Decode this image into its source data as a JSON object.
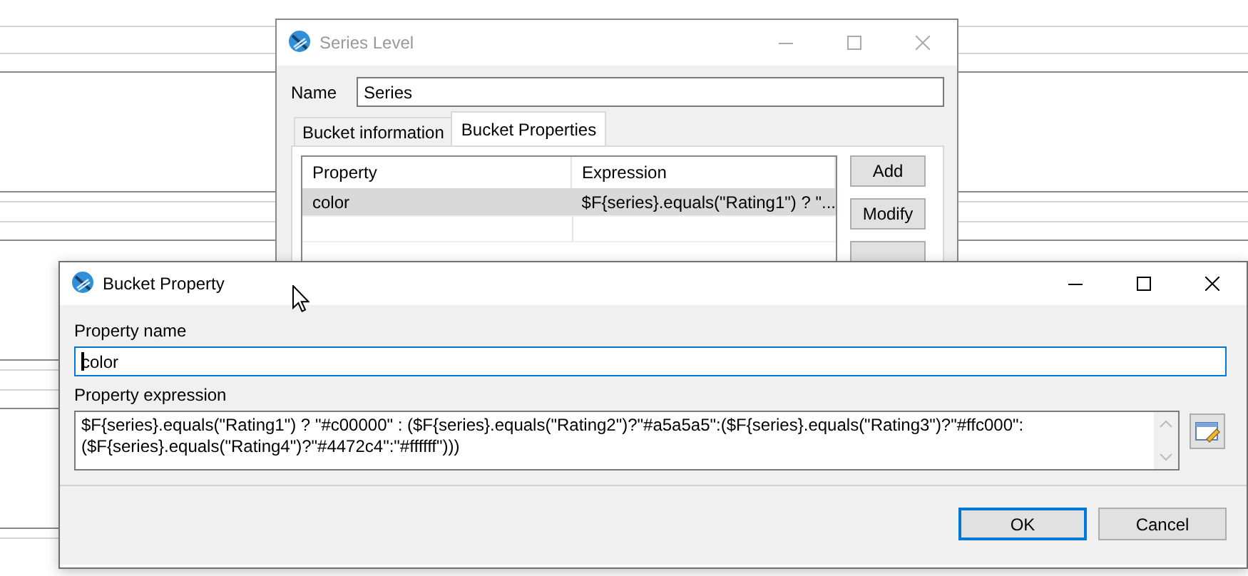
{
  "series_level_window": {
    "title": "Series Level",
    "active": false,
    "name_label": "Name",
    "name_value": "Series",
    "tabs": [
      {
        "label": "Bucket information",
        "selected": false
      },
      {
        "label": "Bucket Properties",
        "selected": true
      }
    ],
    "table": {
      "columns": [
        "Property",
        "Expression"
      ],
      "rows": [
        {
          "cells": [
            "color",
            "$F{series}.equals(\"Rating1\") ? \"..."
          ],
          "selected": true
        }
      ]
    },
    "buttons": [
      "Add",
      "Modify"
    ]
  },
  "bucket_property_window": {
    "title": "Bucket Property",
    "active": true,
    "property_name_label": "Property name",
    "property_name_value": "color",
    "property_expression_label": "Property expression",
    "property_expression_value": "$F{series}.equals(\"Rating1\") ? \"#c00000\" : ($F{series}.equals(\"Rating2\")?\"#a5a5a5\":($F{series}.equals(\"Rating3\")?\"#ffc000\":($F{series}.equals(\"Rating4\")?\"#4472c4\":\"#ffffff\")))",
    "buttons": [
      {
        "label": "OK",
        "default": true
      },
      {
        "label": "Cancel",
        "default": false
      }
    ]
  }
}
